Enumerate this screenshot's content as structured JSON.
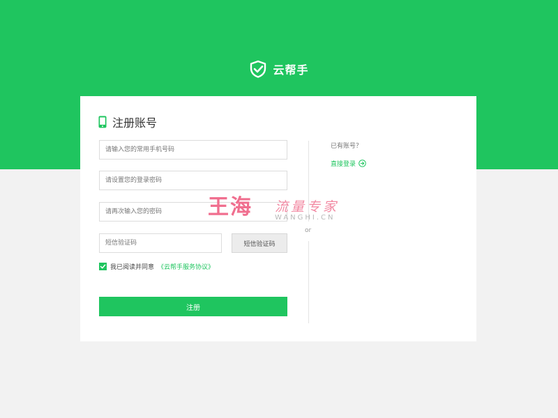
{
  "brand": {
    "name": "云帮手",
    "logo_icon": "shield-check-icon"
  },
  "register": {
    "title": "注册账号",
    "title_icon": "phone-icon",
    "phone_placeholder": "请输入您的常用手机号码",
    "password_placeholder": "请设置您的登录密码",
    "confirm_placeholder": "请再次输入您的密码",
    "sms_code_placeholder": "短信验证码",
    "sms_button_label": "短信验证码",
    "agree_checked": true,
    "agree_prefix": "我已阅读并同意",
    "agree_link": "《云帮手服务协议》",
    "submit_label": "注册"
  },
  "divider": {
    "or_label": "or"
  },
  "login": {
    "prompt": "已有账号？",
    "link_label": "直接登录",
    "link_icon": "arrow-right-circle-icon"
  },
  "watermark": {
    "main_text": "王海",
    "script_text": "流量专家",
    "latin_text": "WANGHI.CN"
  },
  "colors": {
    "brand_green": "#1fc55f",
    "background": "#f2f2f2",
    "watermark_pink": "#f06f8f"
  }
}
